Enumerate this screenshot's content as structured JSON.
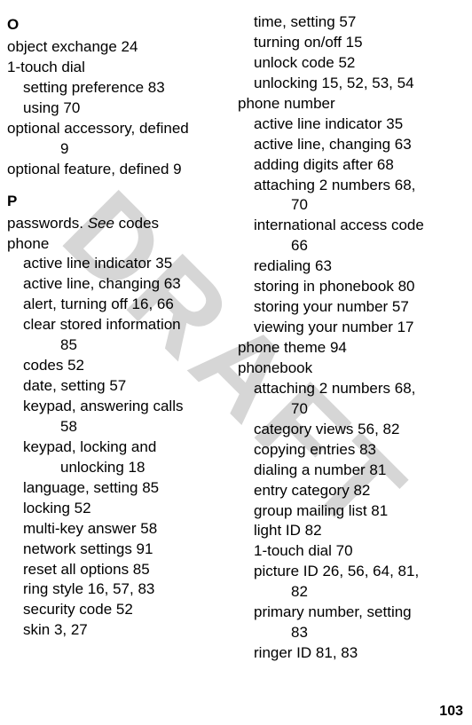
{
  "watermark": "DRAFT",
  "page_number": "103",
  "left_column": {
    "section_O": {
      "heading": "O",
      "lines": [
        {
          "lvl": 0,
          "text": "object exchange  24"
        },
        {
          "lvl": 0,
          "text": "1-touch dial"
        },
        {
          "lvl": 1,
          "text": "setting preference  83"
        },
        {
          "lvl": 1,
          "text": "using  70"
        },
        {
          "lvl": 0,
          "text": "optional accessory, defined"
        },
        {
          "lvl": 2,
          "text": "9"
        },
        {
          "lvl": 0,
          "text": "optional feature, defined  9"
        }
      ]
    },
    "section_P": {
      "heading": "P",
      "lines": [
        {
          "lvl": 0,
          "html": "passwords. <span class=\"italic\">See</span> codes"
        },
        {
          "lvl": 0,
          "text": "phone"
        },
        {
          "lvl": 1,
          "text": "active line indicator  35"
        },
        {
          "lvl": 1,
          "text": "active line, changing  63"
        },
        {
          "lvl": 1,
          "text": "alert, turning off  16, 66"
        },
        {
          "lvl": 1,
          "text": "clear stored information"
        },
        {
          "lvl": 2,
          "text": "85"
        },
        {
          "lvl": 1,
          "text": "codes  52"
        },
        {
          "lvl": 1,
          "text": "date, setting  57"
        },
        {
          "lvl": 1,
          "text": "keypad, answering calls"
        },
        {
          "lvl": 2,
          "text": "58"
        },
        {
          "lvl": 1,
          "text": "keypad, locking and"
        },
        {
          "lvl": 2,
          "text": "unlocking  18"
        },
        {
          "lvl": 1,
          "text": "language, setting  85"
        },
        {
          "lvl": 1,
          "text": "locking  52"
        },
        {
          "lvl": 1,
          "text": "multi-key answer  58"
        },
        {
          "lvl": 1,
          "text": "network settings  91"
        },
        {
          "lvl": 1,
          "text": "reset all options  85"
        },
        {
          "lvl": 1,
          "text": "ring style  16, 57, 83"
        },
        {
          "lvl": 1,
          "text": "security code  52"
        },
        {
          "lvl": 1,
          "text": "skin  3, 27"
        }
      ]
    }
  },
  "right_column": {
    "lines": [
      {
        "lvl": 1,
        "text": "time, setting  57"
      },
      {
        "lvl": 1,
        "text": "turning on/off  15"
      },
      {
        "lvl": 1,
        "text": "unlock code  52"
      },
      {
        "lvl": 1,
        "text": "unlocking  15, 52, 53, 54"
      },
      {
        "lvl": 0,
        "text": "phone number"
      },
      {
        "lvl": 1,
        "text": "active line indicator  35"
      },
      {
        "lvl": 1,
        "text": "active line, changing  63"
      },
      {
        "lvl": 1,
        "text": "adding digits after  68"
      },
      {
        "lvl": 1,
        "text": "attaching 2 numbers  68,"
      },
      {
        "lvl": 2,
        "text": "70"
      },
      {
        "lvl": 1,
        "text": "international access code"
      },
      {
        "lvl": 2,
        "text": "66"
      },
      {
        "lvl": 1,
        "text": "redialing  63"
      },
      {
        "lvl": 1,
        "text": "storing in phonebook  80"
      },
      {
        "lvl": 1,
        "text": "storing your number  57"
      },
      {
        "lvl": 1,
        "text": "viewing your number  17"
      },
      {
        "lvl": 0,
        "text": "phone theme  94"
      },
      {
        "lvl": 0,
        "text": "phonebook"
      },
      {
        "lvl": 1,
        "text": "attaching 2 numbers  68,"
      },
      {
        "lvl": 2,
        "text": "70"
      },
      {
        "lvl": 1,
        "text": "category views  56, 82"
      },
      {
        "lvl": 1,
        "text": "copying entries  83"
      },
      {
        "lvl": 1,
        "text": "dialing a number  81"
      },
      {
        "lvl": 1,
        "text": "entry category  82"
      },
      {
        "lvl": 1,
        "text": "group mailing list  81"
      },
      {
        "lvl": 1,
        "text": "light ID  82"
      },
      {
        "lvl": 1,
        "text": "1-touch dial  70"
      },
      {
        "lvl": 1,
        "text": "picture ID  26, 56, 64, 81,"
      },
      {
        "lvl": 2,
        "text": "82"
      },
      {
        "lvl": 1,
        "text": "primary number, setting"
      },
      {
        "lvl": 2,
        "text": "83"
      },
      {
        "lvl": 1,
        "text": "ringer ID  81, 83"
      }
    ]
  }
}
